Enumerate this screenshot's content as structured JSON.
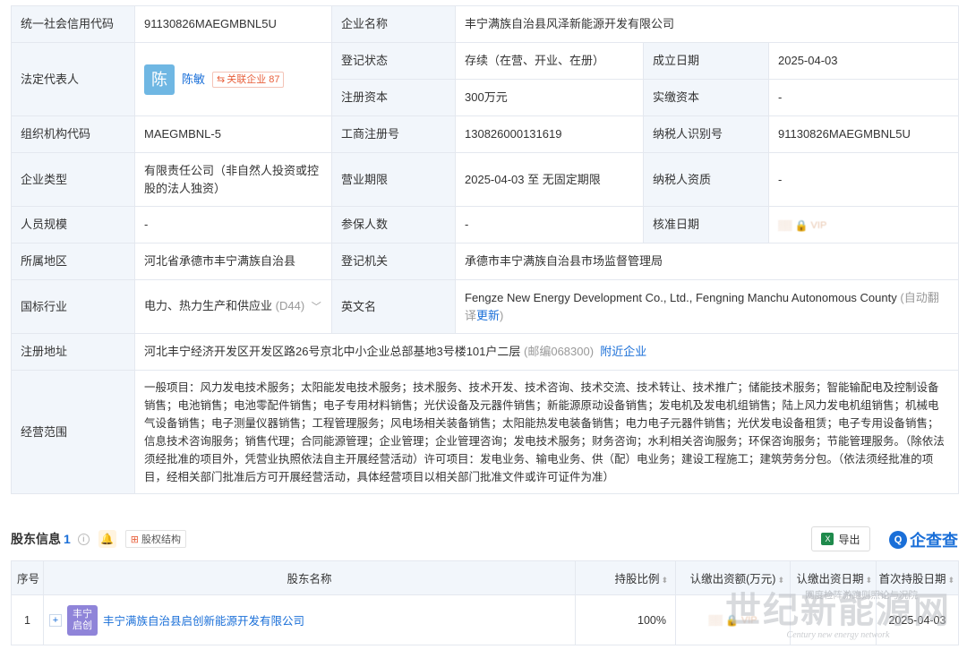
{
  "info": {
    "credit_code_label": "统一社会信用代码",
    "credit_code": "91130826MAEGMBNL5U",
    "company_name_label": "企业名称",
    "company_name": "丰宁满族自治县风泽新能源开发有限公司",
    "legal_rep_label": "法定代表人",
    "legal_rep_avatar": "陈",
    "legal_rep_name": "陈敏",
    "related_label": "关联企业",
    "related_count": "87",
    "reg_status_label": "登记状态",
    "reg_status": "存续（在营、开业、在册）",
    "found_date_label": "成立日期",
    "found_date": "2025-04-03",
    "reg_capital_label": "注册资本",
    "reg_capital": "300万元",
    "paid_capital_label": "实缴资本",
    "paid_capital": "-",
    "org_code_label": "组织机构代码",
    "org_code": "MAEGMBNL-5",
    "biz_reg_no_label": "工商注册号",
    "biz_reg_no": "130826000131619",
    "taxpayer_id_label": "纳税人识别号",
    "taxpayer_id": "91130826MAEGMBNL5U",
    "company_type_label": "企业类型",
    "company_type": "有限责任公司（非自然人投资或控股的法人独资）",
    "biz_term_label": "营业期限",
    "biz_term": "2025-04-03 至 无固定期限",
    "taxpayer_qual_label": "纳税人资质",
    "taxpayer_qual": "-",
    "staff_size_label": "人员规模",
    "staff_size": "-",
    "insured_label": "参保人数",
    "insured": "-",
    "approve_date_label": "核准日期",
    "vip_text": "VIP",
    "region_label": "所属地区",
    "region": "河北省承德市丰宁满族自治县",
    "reg_authority_label": "登记机关",
    "reg_authority": "承德市丰宁满族自治县市场监督管理局",
    "industry_label": "国标行业",
    "industry": "电力、热力生产和供应业",
    "industry_code": "(D44)",
    "english_name_label": "英文名",
    "english_name": "Fengze New Energy Development Co., Ltd., Fengning Manchu Autonomous County",
    "auto_translate": "(自动翻译",
    "update_link": "更新",
    "auto_translate_end": ")",
    "reg_address_label": "注册地址",
    "reg_address": "河北丰宁经济开发区开发区路26号京北中小企业总部基地3号楼101户二层",
    "postal": "(邮编068300)",
    "nearby_link": "附近企业",
    "scope_label": "经营范围",
    "scope": "一般项目：风力发电技术服务；太阳能发电技术服务；技术服务、技术开发、技术咨询、技术交流、技术转让、技术推广；储能技术服务；智能输配电及控制设备销售；电池销售；电池零配件销售；电子专用材料销售；光伏设备及元器件销售；新能源原动设备销售；发电机及发电机组销售；陆上风力发电机组销售；机械电气设备销售；电子测量仪器销售；工程管理服务；风电场相关装备销售；太阳能热发电装备销售；电力电子元器件销售；光伏发电设备租赁；电子专用设备销售；信息技术咨询服务；销售代理；合同能源管理；企业管理；企业管理咨询；发电技术服务；财务咨询；水利相关咨询服务；环保咨询服务；节能管理服务。（除依法须经批准的项目外，凭营业执照依法自主开展经营活动）许可项目：发电业务、输电业务、供（配）电业务；建设工程施工；建筑劳务分包。（依法须经批准的项目，经相关部门批准后方可开展经营活动，具体经营项目以相关部门批准文件或许可证件为准）"
  },
  "shareholders": {
    "title": "股东信息",
    "count": "1",
    "equity_struct_label": "股权结构",
    "export_label": "导出",
    "brand_name": "企查查",
    "columns": [
      "序号",
      "股东名称",
      "持股比例",
      "认缴出资额(万元)",
      "认缴出资日期",
      "首次持股日期"
    ],
    "rows": [
      {
        "index": "1",
        "logo_line1": "丰宁",
        "logo_line2": "启创",
        "name": "丰宁满族自治县启创新能源开发有限公司",
        "ratio": "100%",
        "first_date": "2025-04-03"
      }
    ]
  },
  "watermark": {
    "top_text": "网度检阵游跑则照论与况院",
    "main": "世纪新能源网",
    "sub": "Century new energy network"
  }
}
